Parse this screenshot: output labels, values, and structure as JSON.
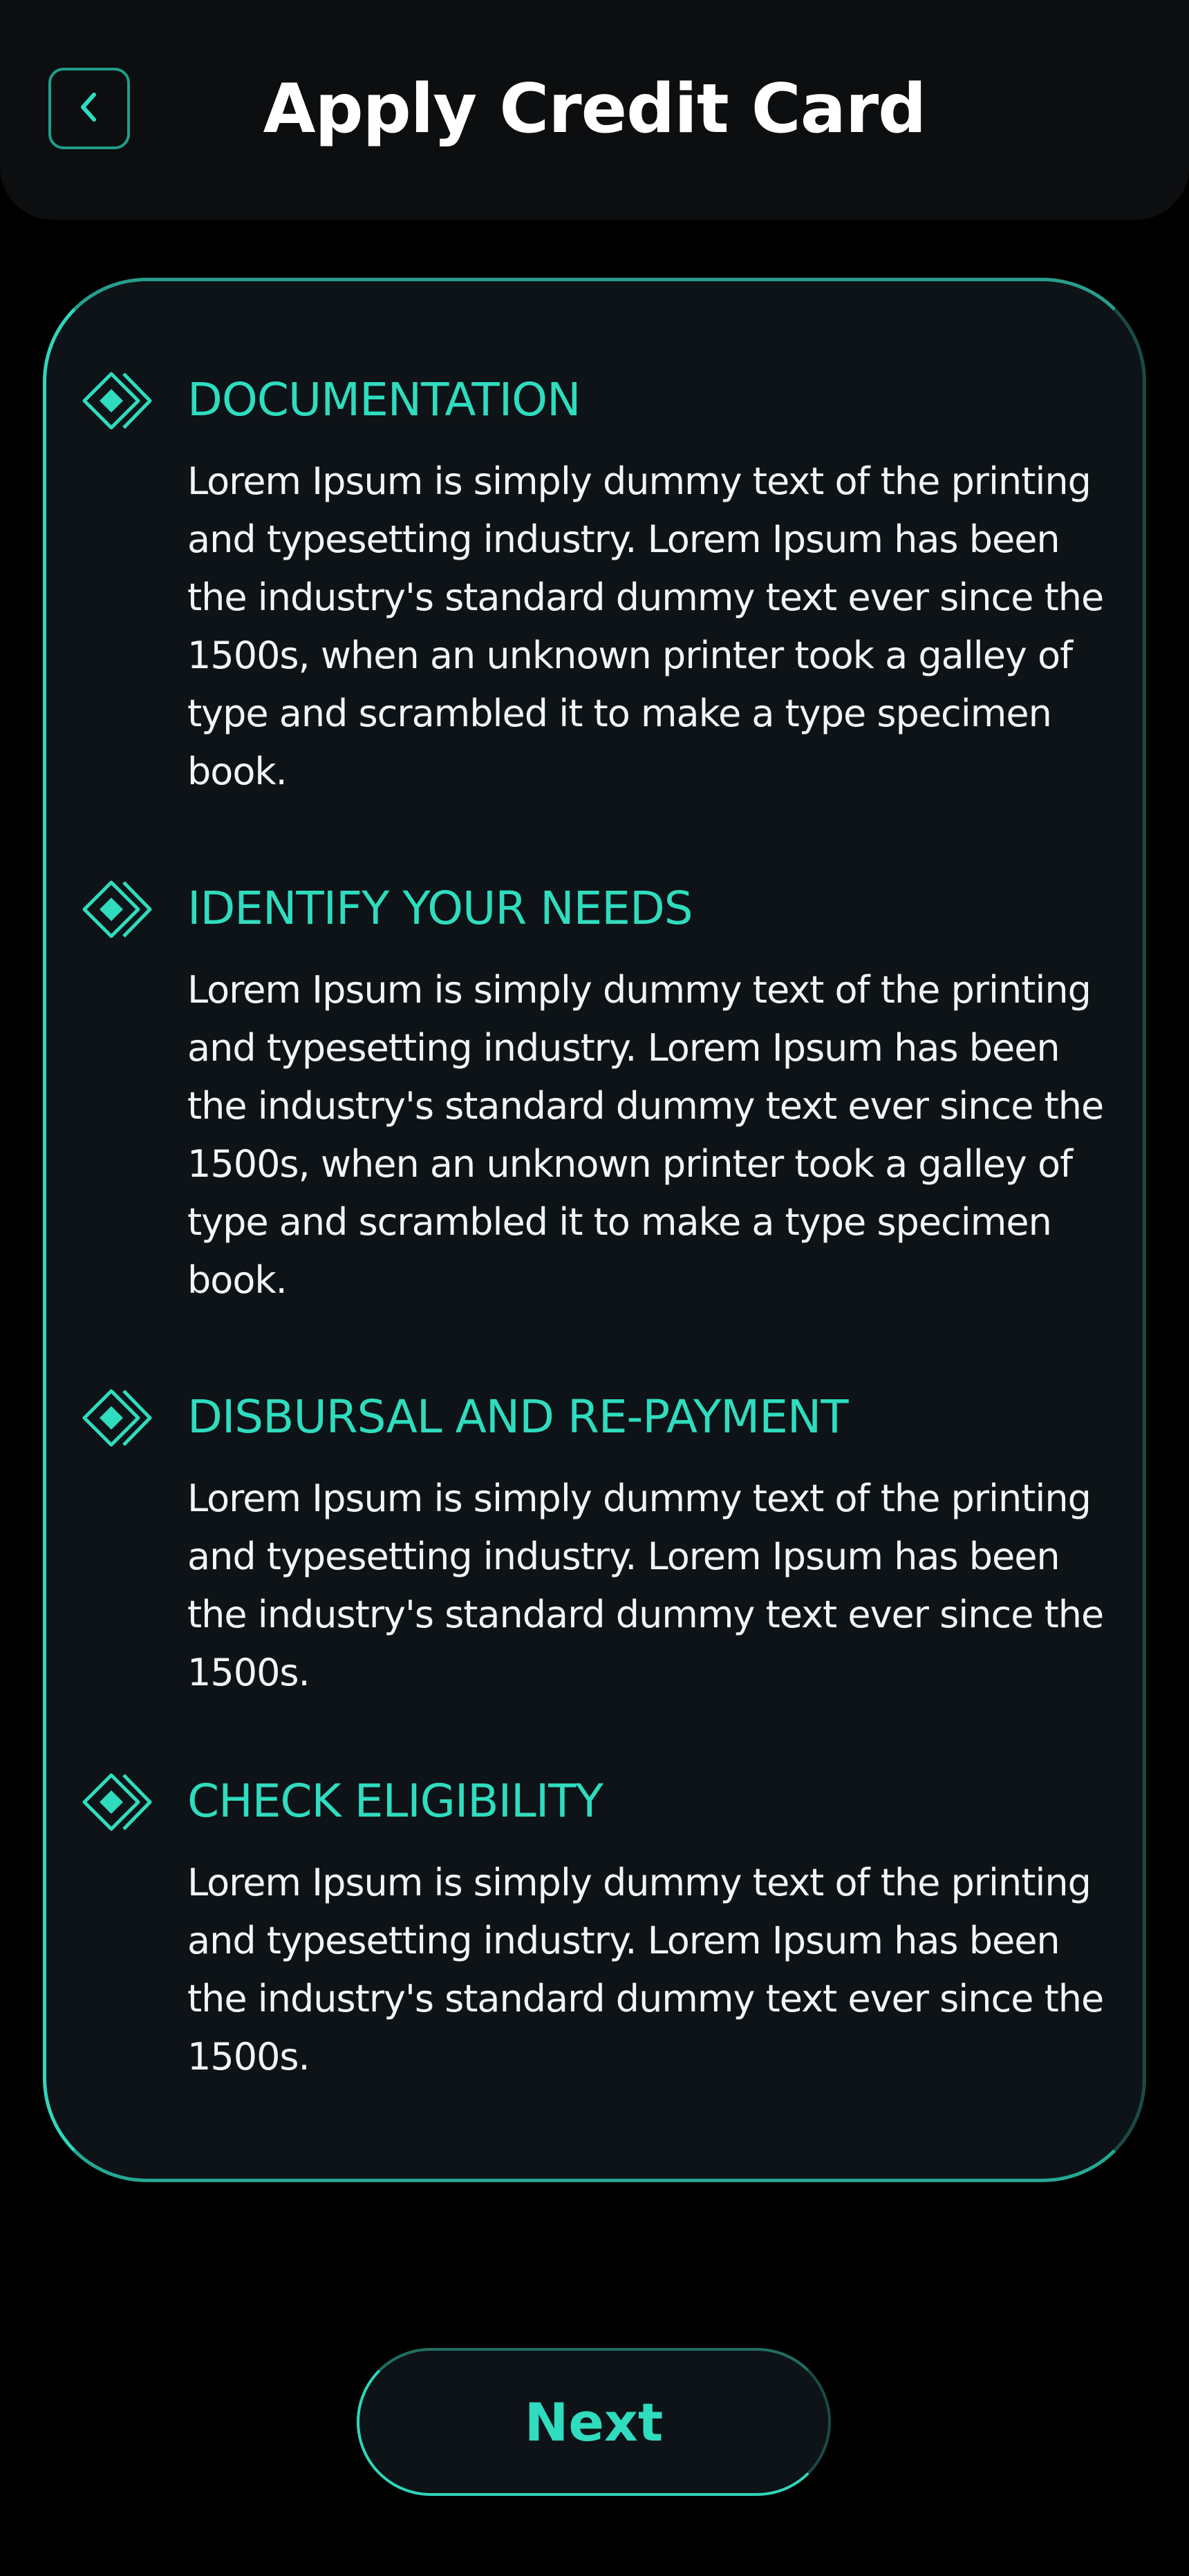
{
  "header": {
    "title": "Apply Credit Card",
    "back_icon": "chevron-left-icon"
  },
  "colors": {
    "accent": "#2fdcbe",
    "background": "#000000",
    "surface": "#0e1317",
    "text": "#ffffff"
  },
  "sections": [
    {
      "icon": "diamond-stack-icon",
      "heading": "DOCUMENTATION",
      "body": "Lorem Ipsum is simply dummy text of the printing and typesetting industry. Lorem Ipsum has been the industry's standard dummy text ever since the 1500s, when an unknown printer took a galley of type and scrambled it to make a type specimen book."
    },
    {
      "icon": "diamond-stack-icon",
      "heading": "IDENTIFY YOUR NEEDS",
      "body": "Lorem Ipsum is simply dummy text of the printing and typesetting industry. Lorem Ipsum has been the industry's standard dummy text ever since the 1500s, when an unknown printer took a galley of type and scrambled it to make a type specimen book."
    },
    {
      "icon": "diamond-stack-icon",
      "heading": "DISBURSAL AND RE-PAYMENT",
      "body": "Lorem Ipsum is simply dummy text of the printing and typesetting industry. Lorem Ipsum has been the industry's standard dummy text ever since the 1500s."
    },
    {
      "icon": "diamond-stack-icon",
      "heading": "CHECK ELIGIBILITY",
      "body": "Lorem Ipsum is simply dummy text of the printing and typesetting industry. Lorem Ipsum has been the industry's standard dummy text ever since the 1500s."
    }
  ],
  "footer": {
    "next_label": "Next"
  }
}
